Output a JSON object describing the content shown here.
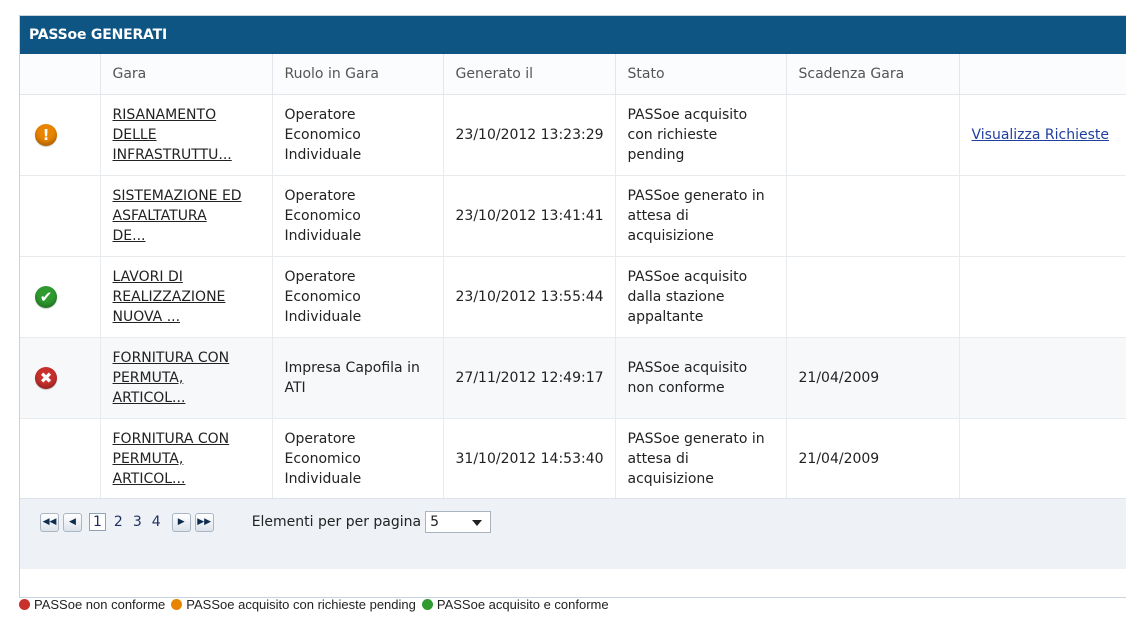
{
  "panel": {
    "title": "PASSoe GENERATI"
  },
  "columns": [
    "",
    "Gara",
    "Ruolo in Gara",
    "Generato il",
    "Stato",
    "Scadenza Gara",
    ""
  ],
  "rows": [
    {
      "status_icon": "warning-icon",
      "gara": [
        "RISANAMENTO",
        "DELLE",
        "INFRASTRUTTU..."
      ],
      "ruolo": [
        "Operatore",
        "Economico",
        "Individuale"
      ],
      "generato": "23/10/2012 13:23:29",
      "stato": [
        "PASSoe acquisito",
        "con richieste",
        "pending"
      ],
      "scadenza": "",
      "action": "Visualizza Richieste"
    },
    {
      "status_icon": "",
      "gara": [
        "SISTEMAZIONE ED",
        "ASFALTATURA",
        "DE..."
      ],
      "ruolo": [
        "Operatore",
        "Economico",
        "Individuale"
      ],
      "generato": "23/10/2012 13:41:41",
      "stato": [
        "PASSoe generato in",
        "attesa di",
        "acquisizione"
      ],
      "scadenza": "",
      "action": ""
    },
    {
      "status_icon": "check-icon",
      "gara": [
        "LAVORI DI",
        "REALIZZAZIONE",
        "NUOVA ..."
      ],
      "ruolo": [
        "Operatore",
        "Economico",
        "Individuale"
      ],
      "generato": "23/10/2012 13:55:44",
      "stato": [
        "PASSoe acquisito",
        "dalla stazione",
        "appaltante"
      ],
      "scadenza": "",
      "action": ""
    },
    {
      "status_icon": "error-icon",
      "gara": [
        "FORNITURA CON",
        "PERMUTA,",
        "ARTICOL..."
      ],
      "ruolo": [
        "Impresa Capofila in",
        "ATI"
      ],
      "generato": "27/11/2012 12:49:17",
      "stato": [
        "PASSoe acquisito",
        "non conforme"
      ],
      "scadenza": "21/04/2009",
      "action": ""
    },
    {
      "status_icon": "",
      "gara": [
        "FORNITURA CON",
        "PERMUTA,",
        "ARTICOL..."
      ],
      "ruolo": [
        "Operatore",
        "Economico",
        "Individuale"
      ],
      "generato": "31/10/2012 14:53:40",
      "stato": [
        "PASSoe generato in",
        "attesa di",
        "acquisizione"
      ],
      "scadenza": "21/04/2009",
      "action": ""
    }
  ],
  "pager": {
    "first_icon": "first-page-icon",
    "prev_icon": "prev-page-icon",
    "next_icon": "next-page-icon",
    "last_icon": "last-page-icon",
    "pages": [
      "1",
      "2",
      "3",
      "4"
    ],
    "current_page": "1",
    "per_page_label": "Elementi per per pagina",
    "per_page_value": "5"
  },
  "legend": [
    {
      "icon": "error-icon",
      "color": "#c9302c",
      "label": "PASSoe non conforme"
    },
    {
      "icon": "warning-icon",
      "color": "#e98400",
      "label": "PASSoe acquisito con richieste pending"
    },
    {
      "icon": "check-icon",
      "color": "#2f9a2f",
      "label": "PASSoe acquisito e conforme"
    }
  ]
}
